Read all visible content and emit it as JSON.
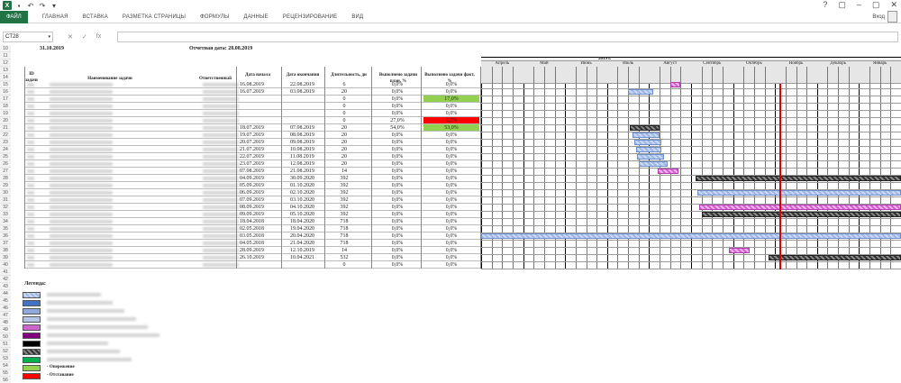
{
  "window": {
    "title_icons": [
      "excel-logo",
      "save-icon",
      "undo-icon",
      "redo-icon",
      "customize-icon"
    ],
    "controls": [
      "?",
      "▢",
      "–",
      "▢",
      "✕"
    ],
    "user_name": "Вход"
  },
  "ribbon": {
    "file_tab": "ФАЙЛ",
    "tabs": [
      "ГЛАВНАЯ",
      "ВСТАВКА",
      "РАЗМЕТКА СТРАНИЦЫ",
      "ФОРМУЛЫ",
      "ДАННЫЕ",
      "РЕЦЕНЗИРОВАНИЕ",
      "ВИД"
    ]
  },
  "formula_bar": {
    "name_box": "CT28",
    "fx": "fx",
    "value": ""
  },
  "row_numbers": [
    "10",
    "11",
    "12",
    "13",
    "14",
    "15",
    "16",
    "17",
    "18",
    "19",
    "20",
    "21",
    "22",
    "23",
    "24",
    "25",
    "26",
    "27",
    "28",
    "29",
    "30",
    "31",
    "32",
    "33",
    "34",
    "35",
    "36",
    "37",
    "38",
    "39",
    "40",
    "41",
    "42",
    "43",
    "44",
    "45",
    "46",
    "47",
    "48",
    "49",
    "50",
    "51",
    "52",
    "53",
    "54",
    "55",
    "56"
  ],
  "sheet": {
    "date_top": "31.10.2019",
    "report_date": "Отчетная дата: 28.08.2019",
    "year_label": "2019 г.",
    "headers": {
      "id": "ID задачи",
      "name": "Наименование задачи",
      "responsible": "Ответственный",
      "start": "Дата начала",
      "end": "Дата окончания",
      "duration": "Длительность, дн",
      "plan": "Выполнено задачи план, %",
      "fact": "Выполнено задачи факт, %"
    },
    "months": [
      "Апрель",
      "Май",
      "Июнь",
      "Июль",
      "Август",
      "Сентябрь",
      "Октябрь",
      "Ноябрь",
      "Декабрь",
      "Январь"
    ],
    "rows": [
      {
        "start": "16.08.2019",
        "end": "22.08.2019",
        "dur": "6",
        "plan": "0,0%",
        "fact": "0,0%",
        "fact_color": ""
      },
      {
        "start": "16.07.2019",
        "end": "03.08.2019",
        "dur": "20",
        "plan": "0,0%",
        "fact": "0,0%",
        "fact_color": ""
      },
      {
        "start": "",
        "end": "",
        "dur": "0",
        "plan": "0,0%",
        "fact": "17,0%",
        "fact_color": "#92d050"
      },
      {
        "start": "",
        "end": "",
        "dur": "0",
        "plan": "0,0%",
        "fact": "0,0%",
        "fact_color": ""
      },
      {
        "start": "",
        "end": "",
        "dur": "0",
        "plan": "0,0%",
        "fact": "0,0%",
        "fact_color": ""
      },
      {
        "start": "",
        "end": "",
        "dur": "0",
        "plan": "27,0%",
        "fact": "0,0%",
        "fact_color": "#ff0000"
      },
      {
        "start": "18.07.2019",
        "end": "07.08.2019",
        "dur": "20",
        "plan": "54,0%",
        "fact": "53,0%",
        "fact_color": "#92d050"
      },
      {
        "start": "19.07.2019",
        "end": "08.08.2019",
        "dur": "20",
        "plan": "0,0%",
        "fact": "0,0%",
        "fact_color": ""
      },
      {
        "start": "20.07.2019",
        "end": "09.08.2019",
        "dur": "20",
        "plan": "0,0%",
        "fact": "0,0%",
        "fact_color": ""
      },
      {
        "start": "21.07.2019",
        "end": "10.08.2019",
        "dur": "20",
        "plan": "0,0%",
        "fact": "0,0%",
        "fact_color": ""
      },
      {
        "start": "22.07.2019",
        "end": "11.08.2019",
        "dur": "20",
        "plan": "0,0%",
        "fact": "0,0%",
        "fact_color": ""
      },
      {
        "start": "23.07.2019",
        "end": "12.08.2019",
        "dur": "20",
        "plan": "0,0%",
        "fact": "0,0%",
        "fact_color": ""
      },
      {
        "start": "07.08.2019",
        "end": "21.08.2019",
        "dur": "14",
        "plan": "0,0%",
        "fact": "0,0%",
        "fact_color": ""
      },
      {
        "start": "04.09.2019",
        "end": "30.09.2020",
        "dur": "392",
        "plan": "0,0%",
        "fact": "0,0%",
        "fact_color": ""
      },
      {
        "start": "05.09.2019",
        "end": "01.10.2020",
        "dur": "392",
        "plan": "0,0%",
        "fact": "0,0%",
        "fact_color": ""
      },
      {
        "start": "06.09.2019",
        "end": "02.10.2020",
        "dur": "392",
        "plan": "0,0%",
        "fact": "0,0%",
        "fact_color": ""
      },
      {
        "start": "07.09.2019",
        "end": "03.10.2020",
        "dur": "392",
        "plan": "0,0%",
        "fact": "0,0%",
        "fact_color": ""
      },
      {
        "start": "08.09.2019",
        "end": "04.10.2020",
        "dur": "392",
        "plan": "0,0%",
        "fact": "0,0%",
        "fact_color": ""
      },
      {
        "start": "09.09.2019",
        "end": "05.10.2020",
        "dur": "392",
        "plan": "0,0%",
        "fact": "0,0%",
        "fact_color": ""
      },
      {
        "start": "18.04.2018",
        "end": "18.04.2020",
        "dur": "718",
        "plan": "0,0%",
        "fact": "0,0%",
        "fact_color": ""
      },
      {
        "start": "02.05.2018",
        "end": "19.04.2020",
        "dur": "718",
        "plan": "0,0%",
        "fact": "0,0%",
        "fact_color": ""
      },
      {
        "start": "03.05.2018",
        "end": "20.04.2020",
        "dur": "718",
        "plan": "0,0%",
        "fact": "0,0%",
        "fact_color": ""
      },
      {
        "start": "04.05.2018",
        "end": "21.04.2020",
        "dur": "718",
        "plan": "0,0%",
        "fact": "0,0%",
        "fact_color": ""
      },
      {
        "start": "28.09.2019",
        "end": "12.10.2019",
        "dur": "14",
        "plan": "0,0%",
        "fact": "0,0%",
        "fact_color": ""
      },
      {
        "start": "26.10.2019",
        "end": "10.04.2021",
        "dur": "532",
        "plan": "0,0%",
        "fact": "0,0%",
        "fact_color": ""
      },
      {
        "start": "",
        "end": "",
        "dur": "0",
        "plan": "0,0%",
        "fact": "0,0%",
        "fact_color": ""
      }
    ],
    "gantt_bars": [
      {
        "row": 0,
        "from": 4.5,
        "to": 4.75,
        "style": "p-pink"
      },
      {
        "row": 1,
        "from": 3.5,
        "to": 4.1,
        "style": "p-blue"
      },
      {
        "row": 6,
        "from": 3.55,
        "to": 4.25,
        "style": "p-dark"
      },
      {
        "row": 7,
        "from": 3.6,
        "to": 4.25,
        "style": "p-blue"
      },
      {
        "row": 8,
        "from": 3.65,
        "to": 4.3,
        "style": "p-blue"
      },
      {
        "row": 9,
        "from": 3.7,
        "to": 4.3,
        "style": "p-blue"
      },
      {
        "row": 10,
        "from": 3.72,
        "to": 4.35,
        "style": "p-blue"
      },
      {
        "row": 11,
        "from": 3.75,
        "to": 4.45,
        "style": "p-blue"
      },
      {
        "row": 12,
        "from": 4.2,
        "to": 4.7,
        "style": "p-pink"
      },
      {
        "row": 13,
        "from": 5.1,
        "to": 10,
        "style": "p-dark"
      },
      {
        "row": 15,
        "from": 5.15,
        "to": 10,
        "style": "p-blue"
      },
      {
        "row": 17,
        "from": 5.2,
        "to": 10,
        "style": "p-pink"
      },
      {
        "row": 18,
        "from": 5.25,
        "to": 10,
        "style": "p-dark"
      },
      {
        "row": 21,
        "from": 0,
        "to": 10,
        "style": "p-blue"
      },
      {
        "row": 23,
        "from": 5.9,
        "to": 6.4,
        "style": "p-pink"
      },
      {
        "row": 24,
        "from": 6.85,
        "to": 10,
        "style": "p-dark"
      }
    ],
    "today_position": 7.1,
    "legend_title": "Легенда:",
    "legend": [
      {
        "color": "p-blue",
        "text": ""
      },
      {
        "color": "#4472c4",
        "text": ""
      },
      {
        "color": "#8eaadb",
        "text": ""
      },
      {
        "color": "#b4c6e7",
        "text": ""
      },
      {
        "color": "#cc66cc",
        "text": ""
      },
      {
        "color": "#800080",
        "text": ""
      },
      {
        "color": "#000000",
        "text": ""
      },
      {
        "color": "p-dark",
        "text": ""
      },
      {
        "color": "#00b050",
        "text": ""
      },
      {
        "color": "#92d050",
        "text": "- Опережение"
      },
      {
        "color": "#ff0000",
        "text": "- Отставание"
      }
    ]
  }
}
